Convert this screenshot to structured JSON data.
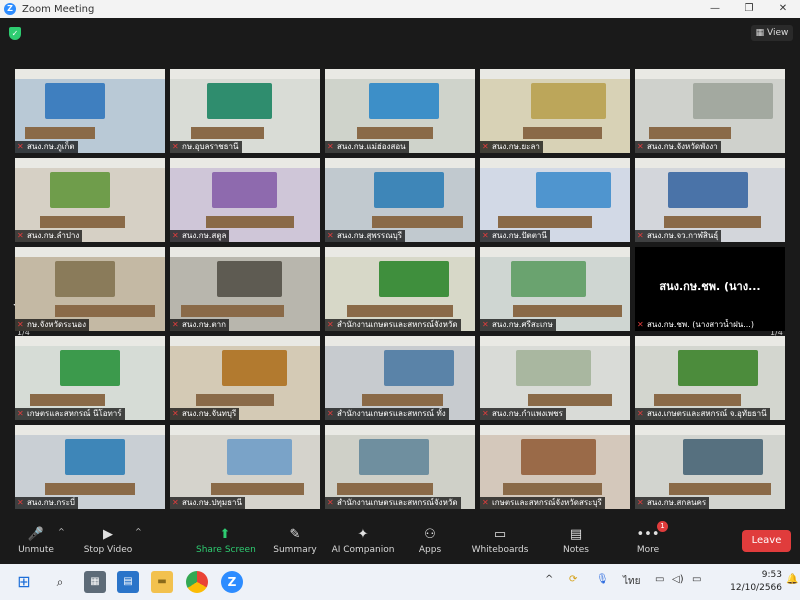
{
  "window": {
    "title": "Zoom Meeting",
    "minimize": "—",
    "maximize": "❐",
    "close": "✕"
  },
  "meeting": {
    "view_label": "View",
    "page_indicator_left": "1/4",
    "page_indicator_right": "1/4",
    "tiles": [
      {
        "label": "สนง.กษ.ภูเก็ต",
        "bg": "#b9c9d6",
        "banner": "#3f7fbf"
      },
      {
        "label": "กษ.อุบลราชธานี",
        "bg": "#d9dcd6",
        "banner": "#2f8d6e"
      },
      {
        "label": "สนง.กษ.แม่ฮ่องสอน",
        "bg": "#cfd3cb",
        "banner": "#3d8fc8"
      },
      {
        "label": "สนง.กษ.ยะลา",
        "bg": "#d8d2b6",
        "banner": "#bca65a"
      },
      {
        "label": "สนง.กษ.จังหวัดพังงา",
        "bg": "#cfd1cc",
        "banner": "#a3a9a0"
      },
      {
        "label": "สนง.กษ.ลำปาง",
        "bg": "#d6d0c5",
        "banner": "#6f9d4b"
      },
      {
        "label": "สนง.กษ.สตูล",
        "bg": "#cfc6d8",
        "banner": "#8e6aae"
      },
      {
        "label": "สนง.กษ.สุพรรณบุรี",
        "bg": "#c1c9cf",
        "banner": "#3e86b8"
      },
      {
        "label": "สนง.กษ.ปัตตานี",
        "bg": "#d2d9e6",
        "banner": "#4f95cf"
      },
      {
        "label": "สนง.กษ.จว.กาฬสินธุ์",
        "bg": "#d3d6db",
        "banner": "#4a73a8"
      },
      {
        "label": "กษ.จังหวัดระนอง",
        "bg": "#c4b9a4",
        "banner": "#8a7b5a"
      },
      {
        "label": "สนง.กษ.ตาก",
        "bg": "#b8b6ad",
        "banner": "#5e5b52"
      },
      {
        "label": "สำนักงานเกษตรและสหกรณ์จังหวัด",
        "bg": "#d7d8c8",
        "banner": "#3f8f3d"
      },
      {
        "label": "สนง.กษ.ศรีสะเกษ",
        "bg": "#cfd6d2",
        "banner": "#6aa36f"
      },
      {
        "label": "สนง.กษ.ชพ. (นางสาวน้ำฝน...)",
        "bg": "#000000",
        "banner": "#000000",
        "name_text": "สนง.กษ.ชพ. (นาง..."
      },
      {
        "label": "เกษตรและสหกรณ์ นีโอทาร์",
        "bg": "#d6dcd6",
        "banner": "#3c9a4c"
      },
      {
        "label": "สนง.กษ.จันทบุรี",
        "bg": "#d4cab5",
        "banner": "#b27a2f"
      },
      {
        "label": "สำนักงานเกษตรและสหกรณ์ ทั้ง",
        "bg": "#c7cbcf",
        "banner": "#5a83a8"
      },
      {
        "label": "สนง.กษ.กำแพงเพชร",
        "bg": "#d9dbd7",
        "banner": "#a9b7a0"
      },
      {
        "label": "สนง.เกษตรและสหกรณ์ จ.อุทัยธานี",
        "bg": "#d3d6cf",
        "banner": "#4c8c3c"
      },
      {
        "label": "สนง.กษ.กระบี่",
        "bg": "#c9cfd4",
        "banner": "#3e86b8"
      },
      {
        "label": "สนง.กษ.ปทุมธานี",
        "bg": "#d5d3cc",
        "banner": "#7aa3c8"
      },
      {
        "label": "สำนักงานเกษตรและสหกรณ์จังหวัด",
        "bg": "#cfd0c8",
        "banner": "#6f8f9f"
      },
      {
        "label": "เกษตรและสหกรณ์จังหวัดสระบุรี",
        "bg": "#d4c8bb",
        "banner": "#9a6a48"
      },
      {
        "label": "สนง.กษ.สกลนคร",
        "bg": "#d2d4cf",
        "banner": "#56707f"
      }
    ]
  },
  "toolbar": {
    "unmute": "Unmute",
    "stop_video": "Stop Video",
    "share_screen": "Share Screen",
    "summary": "Summary",
    "ai_companion": "AI Companion",
    "apps": "Apps",
    "whiteboards": "Whiteboards",
    "notes": "Notes",
    "more": "More",
    "more_badge": "1",
    "leave": "Leave"
  },
  "taskbar": {
    "time": "9:53",
    "date": "12/10/2566",
    "lang": "ไทย"
  }
}
